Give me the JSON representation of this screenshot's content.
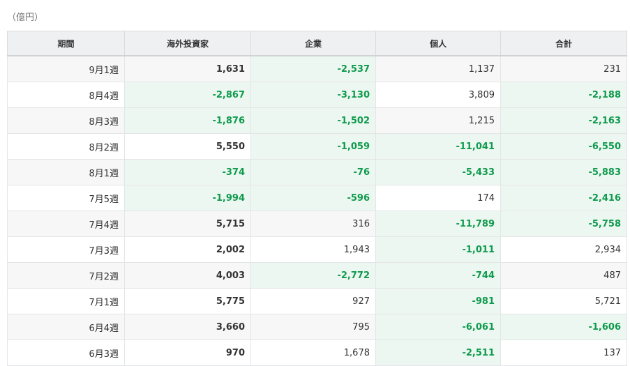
{
  "unit_label": "（億円）",
  "columns": [
    "期間",
    "海外投資家",
    "企業",
    "個人",
    "合計"
  ],
  "rows": [
    {
      "period": "9月1週",
      "foreign": "1,631",
      "corp": "-2,537",
      "individual": "1,137",
      "total": "231"
    },
    {
      "period": "8月4週",
      "foreign": "-2,867",
      "corp": "-3,130",
      "individual": "3,809",
      "total": "-2,188"
    },
    {
      "period": "8月3週",
      "foreign": "-1,876",
      "corp": "-1,502",
      "individual": "1,215",
      "total": "-2,163"
    },
    {
      "period": "8月2週",
      "foreign": "5,550",
      "corp": "-1,059",
      "individual": "-11,041",
      "total": "-6,550"
    },
    {
      "period": "8月1週",
      "foreign": "-374",
      "corp": "-76",
      "individual": "-5,433",
      "total": "-5,883"
    },
    {
      "period": "7月5週",
      "foreign": "-1,994",
      "corp": "-596",
      "individual": "174",
      "total": "-2,416"
    },
    {
      "period": "7月4週",
      "foreign": "5,715",
      "corp": "316",
      "individual": "-11,789",
      "total": "-5,758"
    },
    {
      "period": "7月3週",
      "foreign": "2,002",
      "corp": "1,943",
      "individual": "-1,011",
      "total": "2,934"
    },
    {
      "period": "7月2週",
      "foreign": "4,003",
      "corp": "-2,772",
      "individual": "-744",
      "total": "487"
    },
    {
      "period": "7月1週",
      "foreign": "5,775",
      "corp": "927",
      "individual": "-981",
      "total": "5,721"
    },
    {
      "period": "6月4週",
      "foreign": "3,660",
      "corp": "795",
      "individual": "-6,061",
      "total": "-1,606"
    },
    {
      "period": "6月3週",
      "foreign": "970",
      "corp": "1,678",
      "individual": "-2,511",
      "total": "137"
    }
  ],
  "colors": {
    "negative": "#0e9a4c",
    "negative_bg": "#edf7f1",
    "header_bg": "#eef0f2"
  }
}
